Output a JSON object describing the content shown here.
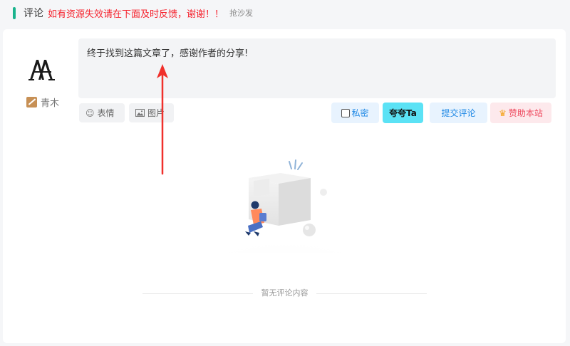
{
  "header": {
    "title": "评论",
    "notice": "如有资源失效请在下面及时反馈，谢谢！！",
    "sofa": "抢沙发"
  },
  "user": {
    "name": "青木",
    "avatar_icon": "qm-logo-avatar",
    "badge_icon": "user-badge-icon"
  },
  "editor": {
    "value": "终于找到这篇文章了，感谢作者的分享!"
  },
  "toolbar": {
    "emoji_label": "表情",
    "image_label": "图片"
  },
  "actions": {
    "private_label": "私密",
    "praise_label": "夸夸Ta",
    "submit_label": "提交评论",
    "sponsor_label": "赞助本站"
  },
  "empty": {
    "text": "暂无评论内容"
  },
  "colors": {
    "accent_green": "#19b38d",
    "notice_red": "#f5222d",
    "primary_blue": "#1e88e5",
    "praise_cyan": "#5be2f5",
    "sponsor_pink": "#fde9ec",
    "sponsor_text": "#ee4a5f",
    "arrow_red": "#f0302b"
  }
}
